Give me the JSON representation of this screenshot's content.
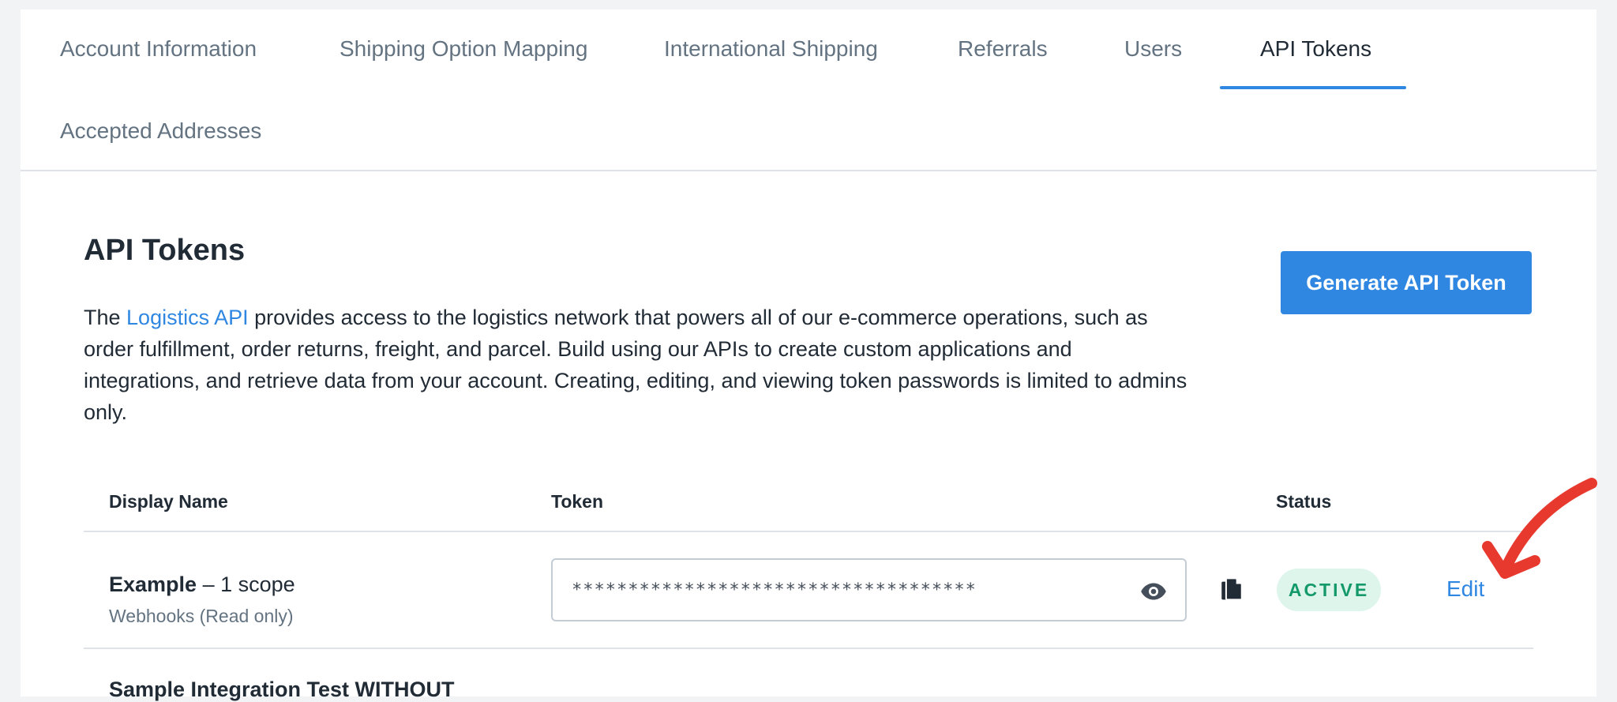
{
  "tabs": [
    {
      "label": "Account Information"
    },
    {
      "label": "Shipping Option Mapping"
    },
    {
      "label": "International Shipping"
    },
    {
      "label": "Referrals"
    },
    {
      "label": "Users"
    },
    {
      "label": "API Tokens",
      "active": true
    },
    {
      "label": "Accepted Addresses"
    }
  ],
  "page": {
    "title": "API Tokens",
    "generate_button": "Generate API Token",
    "description_prefix": "The ",
    "description_link": "Logistics API",
    "description_rest": " provides access to the logistics network that powers all of our e-commerce operations, such as order fulfillment, order returns, freight, and parcel. Build using our APIs to create custom applications and integrations, and retrieve data from your account. Creating, editing, and viewing token passwords is limited to admins only."
  },
  "table": {
    "headers": {
      "name": "Display Name",
      "token": "Token",
      "status": "Status"
    },
    "rows": [
      {
        "name": "Example",
        "scope_count": " – 1 scope",
        "scopes": "Webhooks (Read only)",
        "token_masked": "************************************",
        "status": "ACTIVE",
        "action": "Edit"
      }
    ],
    "next_row_partial": "Sample Integration Test WITHOUT"
  },
  "colors": {
    "accent": "#2f87e2",
    "status_active_bg": "#def5ec",
    "status_active_text": "#14996b",
    "annotation_arrow": "#e8392f"
  },
  "icons": {
    "reveal": "eye-icon",
    "copy": "copy-icon",
    "annotation": "red-arrow-icon"
  }
}
